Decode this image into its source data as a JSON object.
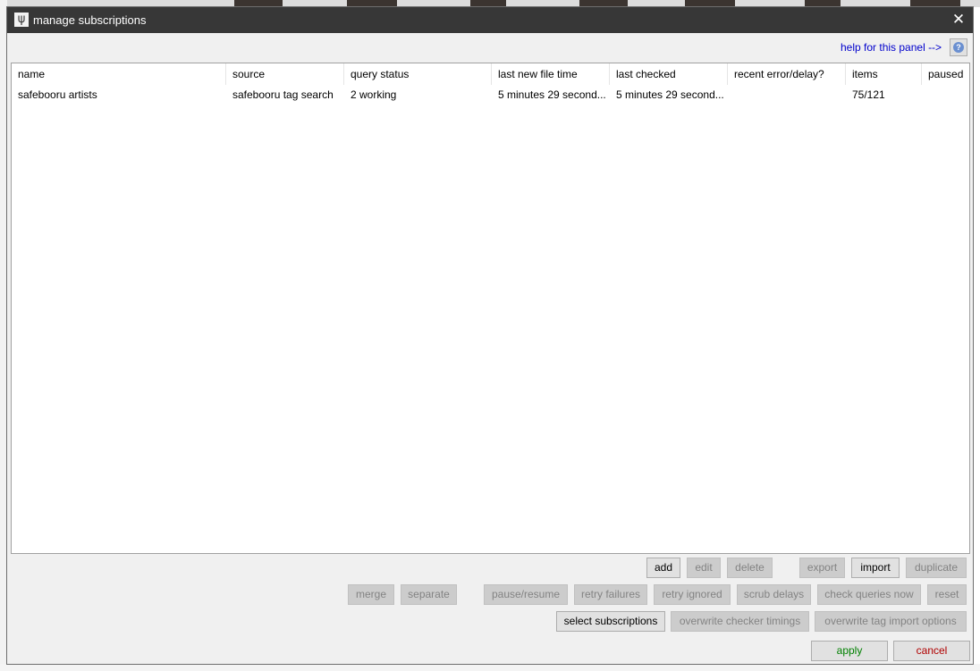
{
  "window": {
    "title": "manage subscriptions",
    "app_icon": "ψ",
    "close_glyph": "✕"
  },
  "help": {
    "link_text": "help for this panel -->",
    "icon": "question-circle-icon"
  },
  "table": {
    "columns": [
      "name",
      "source",
      "query status",
      "last new file time",
      "last checked",
      "recent error/delay?",
      "items",
      "paused"
    ],
    "rows": [
      [
        "safebooru artists",
        "safebooru tag search",
        "2 working",
        "5 minutes 29 second...",
        "5 minutes 29 second...",
        "",
        "75/121",
        ""
      ]
    ]
  },
  "buttons": {
    "add": "add",
    "edit": "edit",
    "delete": "delete",
    "export": "export",
    "import": "import",
    "duplicate": "duplicate",
    "merge": "merge",
    "separate": "separate",
    "pause_resume": "pause/resume",
    "retry_failures": "retry failures",
    "retry_ignored": "retry ignored",
    "scrub_delays": "scrub delays",
    "check_queries_now": "check queries now",
    "reset": "reset",
    "select_subscriptions": "select subscriptions",
    "overwrite_checker_timings": "overwrite checker timings",
    "overwrite_tag_import_options": "overwrite tag import options",
    "apply": "apply",
    "cancel": "cancel"
  },
  "colors": {
    "titlebar": "#373737",
    "dialog_bg": "#f0f0f0",
    "link": "#0000cc",
    "apply_text": "#008000",
    "cancel_text": "#b00000",
    "disabled_button_bg": "#cccccc"
  }
}
